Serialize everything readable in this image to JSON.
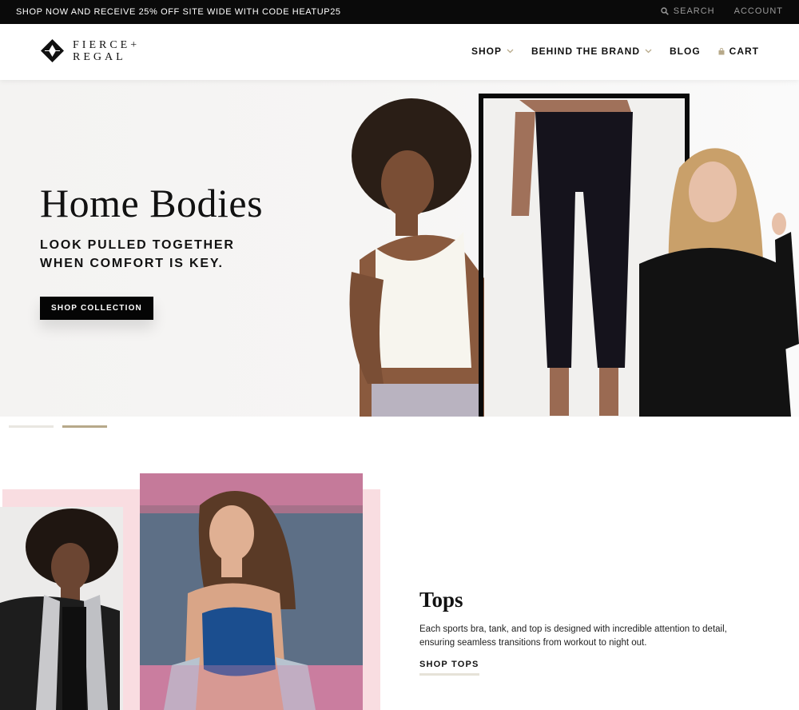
{
  "announcement": {
    "promo_text": "SHOP NOW AND RECEIVE 25% OFF SITE WIDE WITH CODE HEATUP25",
    "search_label": "SEARCH",
    "account_label": "ACCOUNT"
  },
  "header": {
    "logo_line1": "FIERCE+",
    "logo_line2": "REGAL",
    "nav": {
      "shop": "SHOP",
      "behind_the_brand": "BEHIND THE BRAND",
      "blog": "BLOG",
      "cart": "CART"
    },
    "icons": [
      "logo-mark-icon",
      "search-icon",
      "chevron-down-icon",
      "shopping-bag-icon"
    ]
  },
  "hero": {
    "title": "Home Bodies",
    "subtitle_line1": "LOOK PULLED TOGETHER",
    "subtitle_line2": "WHEN COMFORT IS KEY.",
    "cta_label": "SHOP COLLECTION"
  },
  "slider": {
    "slides": 2,
    "active_index": 2
  },
  "tops": {
    "title": "Tops",
    "description": "Each sports bra, tank, and top is designed with incredible attention to detail, ensuring seamless transitions from workout to night out.",
    "link_label": "SHOP TOPS"
  },
  "colors": {
    "announcement_bg": "#0a0a0a",
    "accent_gold": "#b7a98a",
    "pink_block": "#f9dde1",
    "cta_bg": "#050505"
  }
}
